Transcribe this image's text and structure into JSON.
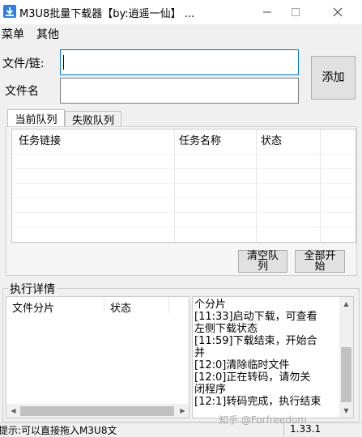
{
  "window": {
    "title": "M3U8批量下载器【by:逍遥一仙】 ...",
    "minimize": "—",
    "maximize": "☐",
    "close": "✕"
  },
  "menu": {
    "items": [
      "菜单",
      "其他"
    ]
  },
  "form": {
    "file_label": "文件/链:",
    "file_value": "",
    "name_label": "文件名",
    "name_value": "",
    "add_button": "添加"
  },
  "tabs": {
    "current": "当前队列",
    "failed": "失败队列"
  },
  "queue": {
    "columns": [
      "任务链接",
      "任务名称",
      "状态"
    ],
    "clear_button": [
      "清空队",
      "列"
    ],
    "start_all_button": [
      "全部开",
      "始"
    ]
  },
  "details": {
    "group_label": "执行详情",
    "columns": [
      "文件分片",
      "状态"
    ],
    "log_lines": [
      "个分片",
      "[11:33]启动下载，可查看",
      "左侧下载状态",
      "[11:59]下载结束，开始合",
      "并",
      "[12:0]清除临时文件",
      "[12:0]正在转码，请勿关",
      "闭程序",
      "[12:1]转码完成，执行结束"
    ]
  },
  "status_bar": {
    "tip": "提示:可以直接拖入M3U8文",
    "version": "1.33.1",
    "watermark": "知乎 @Forfreedom"
  },
  "colors": {
    "focus_border": "#0078d7",
    "button_bg": "#e1e1e1"
  }
}
